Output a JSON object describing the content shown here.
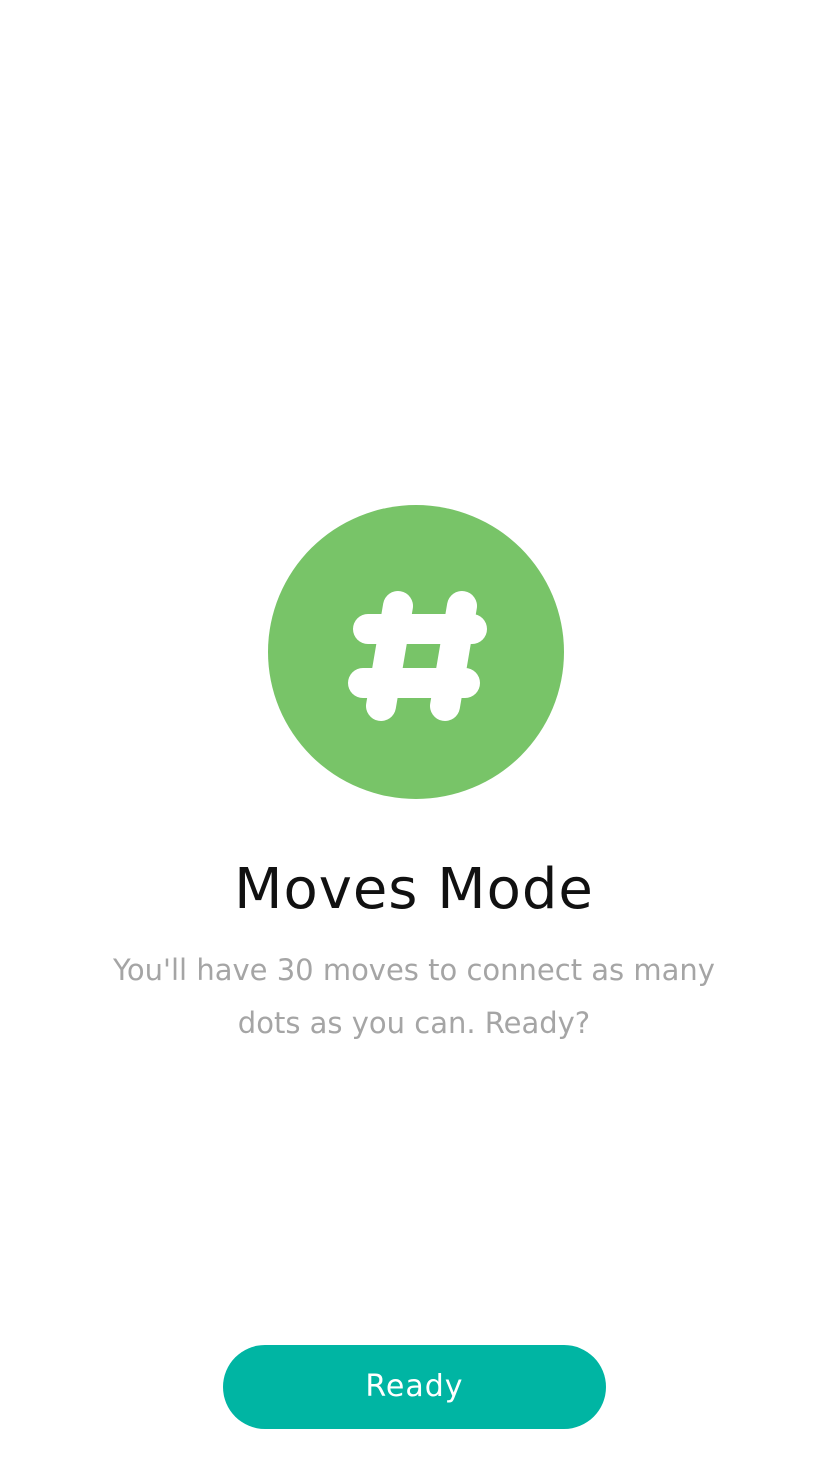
{
  "mode": {
    "icon": "hash-icon",
    "title": "Moves Mode",
    "description": "You'll have 30 moves to connect as many dots as you can. Ready?"
  },
  "actions": {
    "ready_label": "Ready"
  },
  "colors": {
    "icon_circle": "#78c468",
    "button": "#00b5a3",
    "title_text": "#111111",
    "description_text": "#a5a5a5"
  }
}
